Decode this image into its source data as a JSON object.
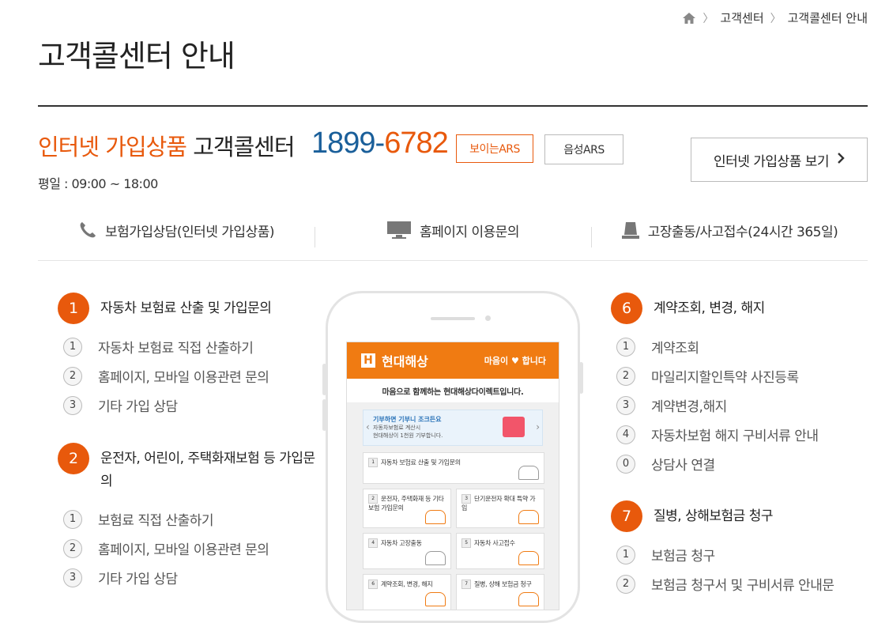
{
  "breadcrumb": {
    "home_icon": "home-icon",
    "items": [
      "고객센터",
      "고객콜센터 안내"
    ]
  },
  "page_title": "고객콜센터 안내",
  "callcenter": {
    "title_highlight": "인터넷 가입상품",
    "title_rest": " 고객콜센터",
    "phone_prefix": "1899-",
    "phone_suffix": "6782",
    "btn_visible_ars": "보이는ARS",
    "btn_voice_ars": "음성ARS",
    "btn_view_products": "인터넷 가입상품 보기",
    "hours": "평일 : 09:00 ~ 18:00"
  },
  "categories": [
    {
      "icon": "phone-icon",
      "label": "보험가입상담(인터넷 가입상품)"
    },
    {
      "icon": "monitor-icon",
      "label": "홈페이지 이용문의"
    },
    {
      "icon": "siren-icon",
      "label": "고장출동/사고접수(24시간 365일)"
    }
  ],
  "left_menu": [
    {
      "num": "1",
      "label": "자동차 보험료 산출 및 가입문의",
      "subs": [
        {
          "num": "1",
          "label": "자동차 보험료 직접 산출하기"
        },
        {
          "num": "2",
          "label": "홈페이지, 모바일 이용관련 문의"
        },
        {
          "num": "3",
          "label": "기타 가입 상담"
        }
      ]
    },
    {
      "num": "2",
      "label": "운전자, 어린이, 주택화재보험 등 가입문의",
      "subs": [
        {
          "num": "1",
          "label": "보험료 직접 산출하기"
        },
        {
          "num": "2",
          "label": "홈페이지, 모바일 이용관련 문의"
        },
        {
          "num": "3",
          "label": "기타 가입 상담"
        }
      ]
    }
  ],
  "right_menu": [
    {
      "num": "6",
      "label": "계약조회, 변경, 해지",
      "subs": [
        {
          "num": "1",
          "label": "계약조회"
        },
        {
          "num": "2",
          "label": "마일리지할인특약 사진등록"
        },
        {
          "num": "3",
          "label": "계약변경,해지"
        },
        {
          "num": "4",
          "label": "자동차보험 해지 구비서류 안내"
        },
        {
          "num": "0",
          "label": "상담사 연결"
        }
      ]
    },
    {
      "num": "7",
      "label": "질병, 상해보험금 청구",
      "subs": [
        {
          "num": "1",
          "label": "보험금 청구"
        },
        {
          "num": "2",
          "label": "보험금 청구서 및 구비서류 안내문"
        }
      ]
    }
  ],
  "phone_screen": {
    "logo": "현대해상",
    "slogan": "마음이 ♥ 합니다",
    "banner": "마음으로 함께하는 현대해상다이렉트입니다.",
    "promo_title": "기부하면 기부니 조크든요",
    "promo_line1": "자동차보험료 계산시",
    "promo_line2": "현대해상이 1천원 기부합니다.",
    "items": [
      {
        "num": "1",
        "label": "자동차 보험료 산출 및 가입문의"
      },
      {
        "num": "2",
        "label": "운전자, 주택화재 등 기타보험 가입문의"
      },
      {
        "num": "3",
        "label": "단기운전자 확대 특약 가입"
      },
      {
        "num": "4",
        "label": "자동차 고장출동"
      },
      {
        "num": "5",
        "label": "자동차 사고접수"
      },
      {
        "num": "6",
        "label": "계약조회, 변경, 해지"
      },
      {
        "num": "7",
        "label": "질병, 상해 보험금 청구"
      }
    ]
  },
  "colors": {
    "accent": "#e8590c",
    "phone_blue": "#1a5f9a",
    "app_orange": "#f07b12"
  }
}
